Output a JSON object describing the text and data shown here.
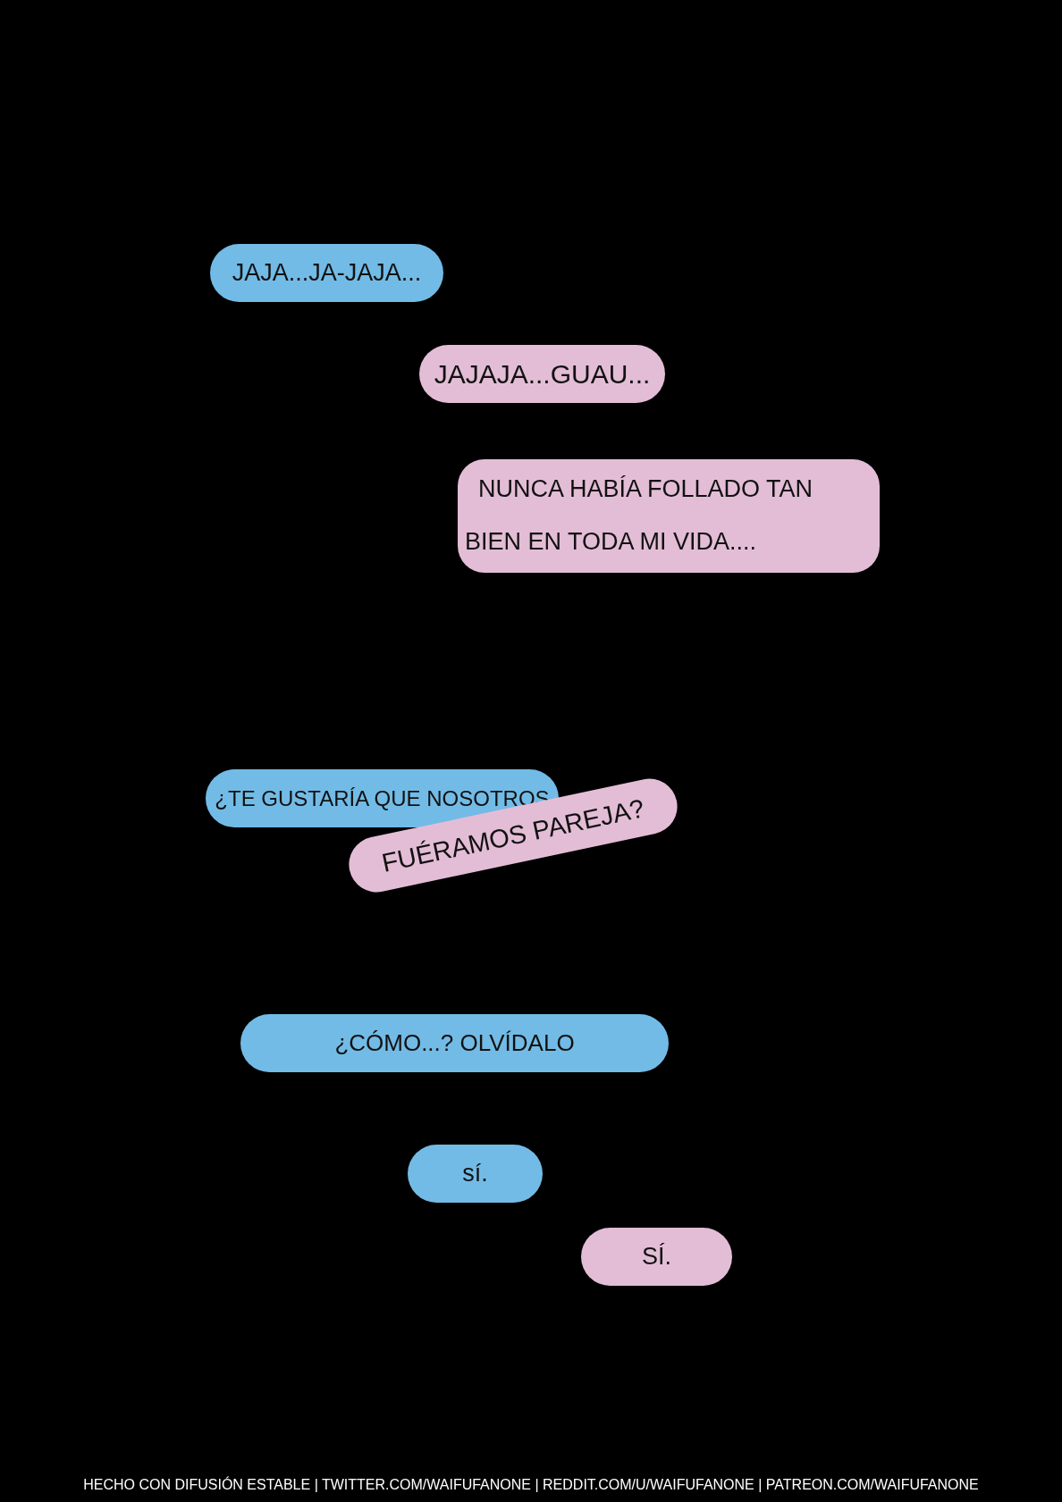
{
  "messages": [
    {
      "color": "#72bbe6",
      "lines": [
        "JAJA...JA-JAJA..."
      ]
    },
    {
      "color": "#e3bdd6",
      "lines": [
        "JAJAJA...GUAU..."
      ]
    },
    {
      "color": "#e3bdd6",
      "lines": [
        "NUNCA HABÍA FOLLADO TAN",
        "BIEN EN TODA MI VIDA...."
      ]
    },
    {
      "color": "#72bbe6",
      "lines": [
        "¿TE GUSTARÍA QUE NOSOTROS"
      ]
    },
    {
      "color": "#e3bdd6",
      "lines": [
        "FUÉRAMOS PAREJA?"
      ]
    },
    {
      "color": "#72bbe6",
      "lines": [
        "¿CÓMO...? OLVÍDALO"
      ]
    },
    {
      "color": "#72bbe6",
      "lines": [
        "sí."
      ]
    },
    {
      "color": "#e3bdd6",
      "lines": [
        "SÍ."
      ]
    }
  ],
  "footer": {
    "credit": "HECHO CON DIFUSIÓN ESTABLE | TWITTER.COM/WAIFUFANONE | REDDIT.COM/U/WAIFUFANONE | PATREON.COM/WAIFUFANONE"
  }
}
